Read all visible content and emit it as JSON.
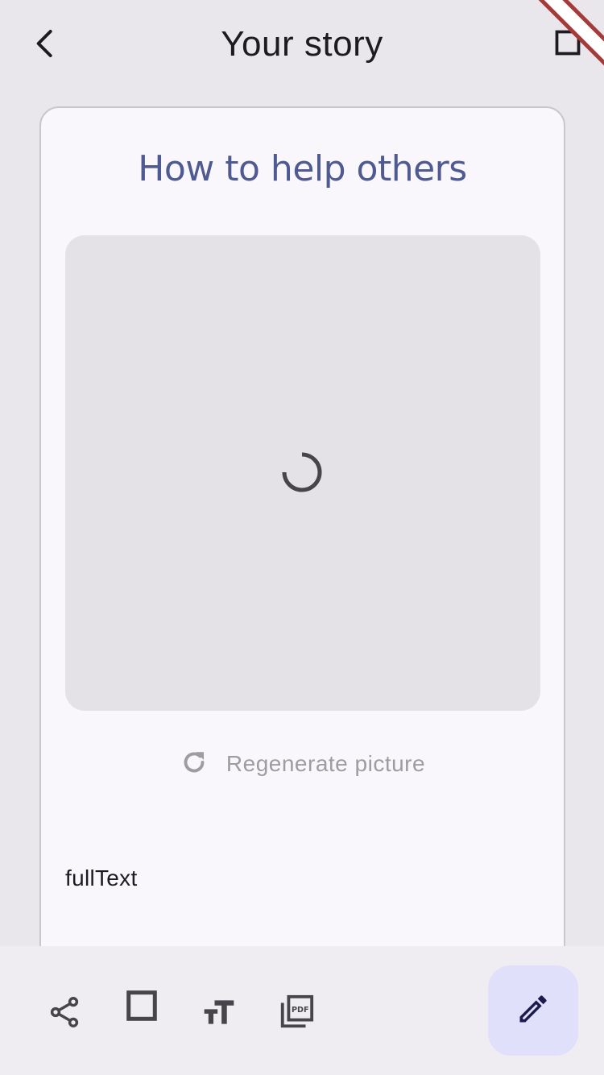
{
  "appbar": {
    "title": "Your story",
    "back_icon": "chevron-left-icon",
    "action_icon": "square-icon"
  },
  "story": {
    "title": "How to help others",
    "picture_state": "loading",
    "regenerate_label": "Regenerate picture",
    "full_text": "fullText"
  },
  "toolbar": {
    "items": [
      {
        "icon": "share-icon"
      },
      {
        "icon": "crop-square-icon"
      },
      {
        "icon": "text-size-icon"
      },
      {
        "icon": "pdf-icon"
      }
    ],
    "fab_icon": "edit-pencil-icon"
  },
  "colors": {
    "background": "#e9e7ec",
    "card": "#f9f7fc",
    "title_accent": "#4f5a92",
    "fab": "#e1e0fb",
    "muted_text": "#9e9ca3",
    "debug_ribbon": "#a43b3b"
  }
}
